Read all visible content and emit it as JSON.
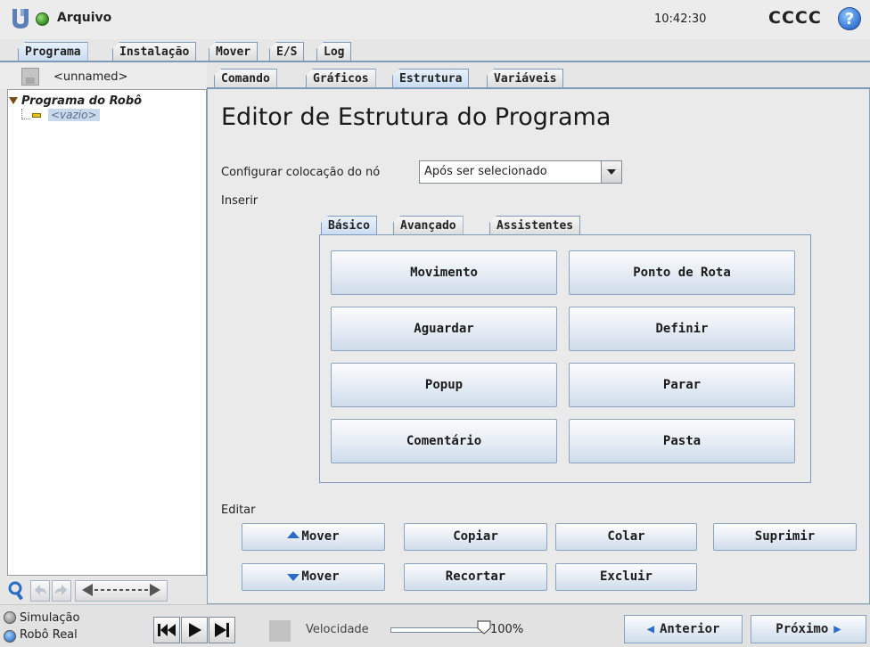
{
  "header": {
    "file_label": "Arquivo",
    "clock": "10:42:30",
    "robot_name": "CCCC",
    "help": "?"
  },
  "main_tabs": [
    {
      "label": "Programa",
      "active": true
    },
    {
      "label": "Instalação",
      "active": false
    },
    {
      "label": "Mover",
      "active": false
    },
    {
      "label": "E/S",
      "active": false
    },
    {
      "label": "Log",
      "active": false
    }
  ],
  "left_panel": {
    "program_name": "<unnamed>",
    "tree_root": "Programa do Robô",
    "tree_node": "<vazio>"
  },
  "sub_tabs": [
    {
      "label": "Comando",
      "active": false
    },
    {
      "label": "Gráficos",
      "active": false
    },
    {
      "label": "Estrutura",
      "active": true
    },
    {
      "label": "Variáveis",
      "active": false
    }
  ],
  "editor": {
    "title": "Editor de Estrutura do Programa",
    "placement_label": "Configurar colocação do nó",
    "placement_value": "Após ser selecionado",
    "insert_label": "Inserir",
    "edit_label": "Editar"
  },
  "insert_tabs": [
    {
      "label": "Básico",
      "active": true
    },
    {
      "label": "Avançado",
      "active": false
    },
    {
      "label": "Assistentes",
      "active": false
    }
  ],
  "insert_buttons": [
    "Movimento",
    "Ponto de Rota",
    "Aguardar",
    "Definir",
    "Popup",
    "Parar",
    "Comentário",
    "Pasta"
  ],
  "edit_buttons": {
    "move_up": "Mover",
    "copy": "Copiar",
    "paste": "Colar",
    "suppress": "Suprimir",
    "move_down": "Mover",
    "cut": "Recortar",
    "delete": "Excluir"
  },
  "footer": {
    "simulation": "Simulação",
    "real_robot": "Robô Real",
    "speed_label": "Velocidade",
    "speed_value": "100%",
    "speed_fraction": 1.0,
    "prev": "Anterior",
    "next": "Próximo"
  },
  "colors": {
    "accent_blue": "#2b6cc4",
    "tab_border": "#7d9ab8",
    "status_green": "#2e8b1e"
  }
}
